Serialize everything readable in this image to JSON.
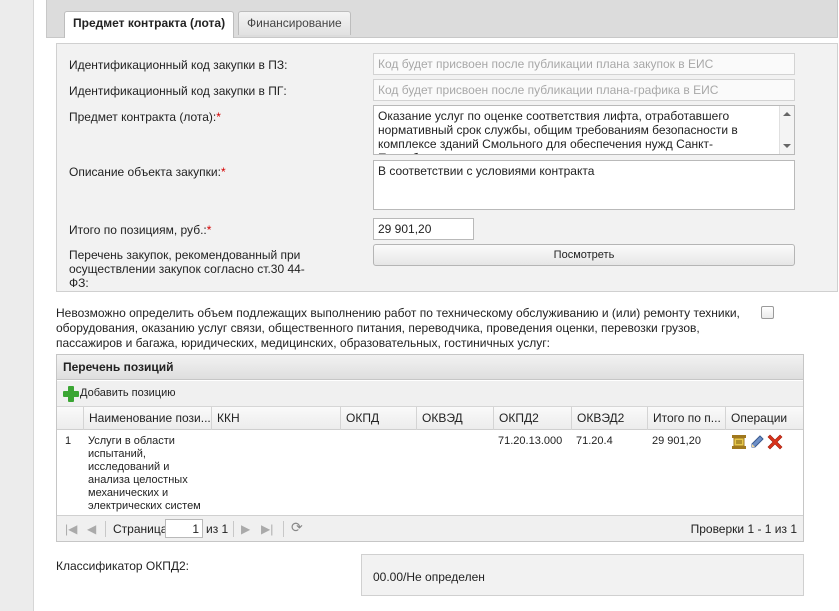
{
  "tabs": [
    {
      "label": "Предмет контракта (лота)",
      "active": true
    },
    {
      "label": "Финансирование",
      "active": false
    }
  ],
  "form": {
    "ikz_pz_label": "Идентификационный код закупки в ПЗ:",
    "ikz_pz_placeholder": "Код будет присвоен после публикации плана закупок в ЕИС",
    "ikz_pg_label": "Идентификационный код закупки в ПГ:",
    "ikz_pg_placeholder": "Код будет присвоен после публикации плана-графика в ЕИС",
    "subject_label": "Предмет контракта (лота):",
    "subject_value": "Оказание услуг по оценке соответствия лифта, отработавшего нормативный срок службы, общим требованиям безопасности в комплексе зданий Смольного для обеспечения нужд Санкт-Петербурга",
    "description_label": "Описание объекта закупки:",
    "description_value": "В соответствии с условиями контракта",
    "total_label": "Итого по позициям, руб.:",
    "total_value": "29 901,20",
    "list_label": "Перечень закупок, рекомендованный при осуществлении закупок согласно ст.30 44-ФЗ:",
    "view_button": "Посмотреть",
    "required_mark": "*"
  },
  "impossible_text": "Невозможно определить объем подлежащих выполнению работ по техническому обслуживанию и (или) ремонту техники, оборудования, оказанию услуг связи, общественного питания, переводчика, проведения оценки, перевозки грузов, пассажиров и багажа, юридических, медицинских, образовательных, гостиничных услуг:",
  "grid": {
    "title": "Перечень позиций",
    "add_label": "Добавить позицию",
    "columns": [
      "Наименование пози...",
      "ККН",
      "ОКПД",
      "ОКВЭД",
      "ОКПД2",
      "ОКВЭД2",
      "Итого по п...",
      "Операции"
    ],
    "rows": [
      {
        "num": "1",
        "name": "Услуги в области испытаний, исследований и анализа целостных механических и электрических систем",
        "kkn": "",
        "okpd": "",
        "okved": "",
        "okpd2": "71.20.13.000",
        "okved2": "71.20.4",
        "total": "29 901,20"
      }
    ],
    "pager": {
      "page_label": "Страница",
      "page_value": "1",
      "of_label": "из 1",
      "status": "Проверки 1 - 1 из 1"
    }
  },
  "okpd2": {
    "label": "Классификатор ОКПД2:",
    "value": "00.00/Не определен"
  },
  "colors": {
    "required": "#d40000",
    "add_icon": "#3aa533",
    "delete_icon": "#d9321b"
  }
}
